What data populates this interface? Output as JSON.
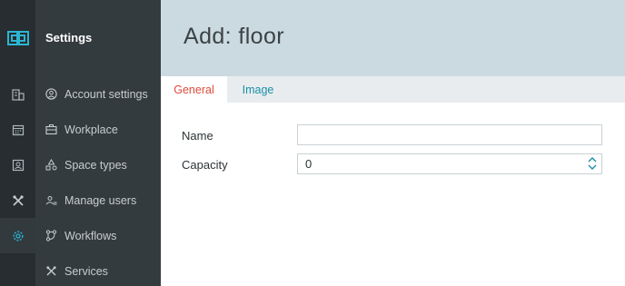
{
  "sidebar": {
    "title": "Settings",
    "items": [
      {
        "label": "Account settings",
        "icon": "user-circle-icon"
      },
      {
        "label": "Workplace",
        "icon": "briefcase-icon"
      },
      {
        "label": "Space types",
        "icon": "shapes-icon"
      },
      {
        "label": "Manage users",
        "icon": "users-icon"
      },
      {
        "label": "Workflows",
        "icon": "workflow-icon"
      },
      {
        "label": "Services",
        "icon": "tools-icon"
      }
    ]
  },
  "rail": {
    "logo_icon": "app-logo-icon",
    "items": [
      {
        "icon": "building-icon"
      },
      {
        "icon": "calendar-icon"
      },
      {
        "icon": "badge-icon"
      },
      {
        "icon": "tools-icon"
      },
      {
        "icon": "gear-icon",
        "active": true
      }
    ]
  },
  "header": {
    "title": "Add: floor"
  },
  "tabs": [
    {
      "label": "General",
      "active": true
    },
    {
      "label": "Image",
      "active": false
    }
  ],
  "form": {
    "name_label": "Name",
    "name_value": "",
    "capacity_label": "Capacity",
    "capacity_value": "0"
  },
  "colors": {
    "accent": "#1a8fa8",
    "active_tab": "#e24a3b",
    "header_bg": "#cbdae1",
    "rail_bg": "#272d30",
    "sidebar_bg": "#343b3f"
  }
}
